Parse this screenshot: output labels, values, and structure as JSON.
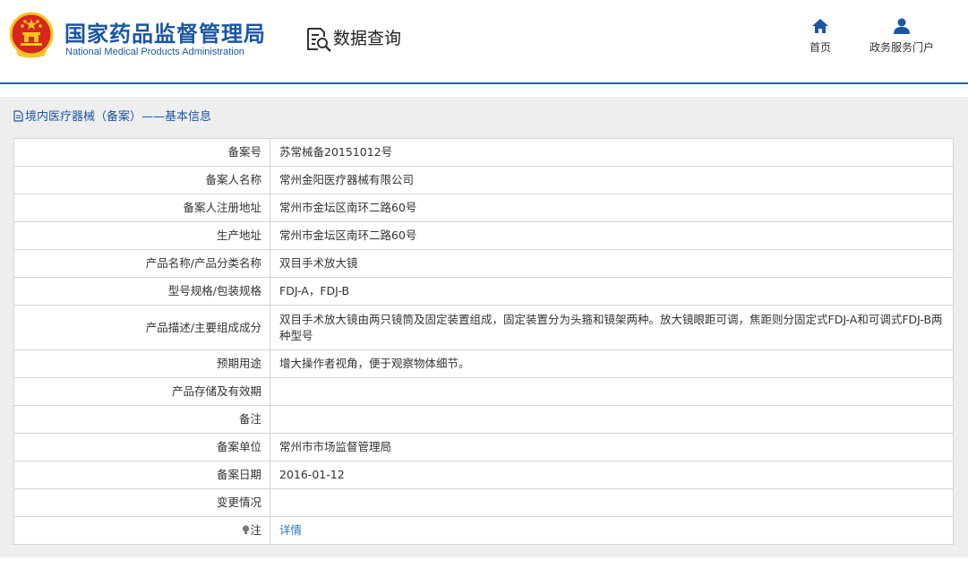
{
  "header": {
    "org_cn": "国家药品监督管理局",
    "org_en": "National Medical Products Administration",
    "section_title": "数据查询",
    "nav": [
      {
        "label": "首页",
        "icon": "home-icon"
      },
      {
        "label": "政务服务门户",
        "icon": "user-icon"
      }
    ]
  },
  "panel": {
    "title": "境内医疗器械（备案）——基本信息",
    "title_icon": "document-icon"
  },
  "record": {
    "rows": [
      {
        "key": "备案号",
        "value": "苏常械备20151012号"
      },
      {
        "key": "备案人名称",
        "value": "常州金阳医疗器械有限公司"
      },
      {
        "key": "备案人注册地址",
        "value": "常州市金坛区南环二路60号"
      },
      {
        "key": "生产地址",
        "value": "常州市金坛区南环二路60号"
      },
      {
        "key": "产品名称/产品分类名称",
        "value": "双目手术放大镜"
      },
      {
        "key": "型号规格/包装规格",
        "value": "FDJ-A，FDJ-B"
      },
      {
        "key": "产品描述/主要组成成分",
        "value": "双目手术放大镜由两只镜筒及固定装置组成，固定装置分为头箍和镜架两种。放大镜眼距可调，焦距则分固定式FDJ-A和可调式FDJ-B两种型号"
      },
      {
        "key": "预期用途",
        "value": "增大操作者视角，便于观察物体细节。"
      },
      {
        "key": "产品存储及有效期",
        "value": ""
      },
      {
        "key": "备注",
        "value": ""
      },
      {
        "key": "备案单位",
        "value": "常州市市场监督管理局"
      },
      {
        "key": "备案日期",
        "value": "2016-01-12"
      },
      {
        "key": "变更情况",
        "value": ""
      }
    ],
    "note_key": "注",
    "note_link": "详情"
  },
  "colors": {
    "brand_blue": "#1a56a3",
    "emblem_red": "#d7261e",
    "emblem_gold": "#f6c423",
    "link": "#2a7ab8",
    "panel_bg": "#eeeeee",
    "border": "#d4d4d4"
  }
}
